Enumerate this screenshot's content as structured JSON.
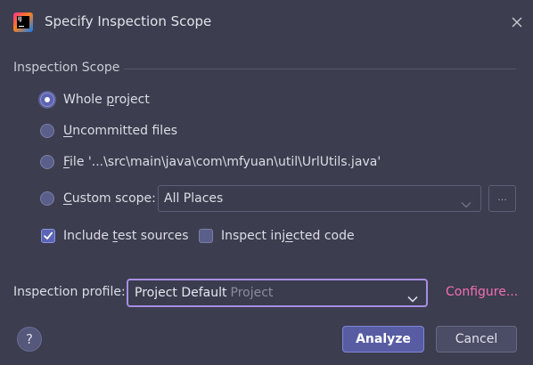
{
  "window": {
    "title": "Specify Inspection Scope",
    "logo_text": "IJ",
    "close_icon": "close-icon"
  },
  "scope": {
    "section_title": "Inspection Scope",
    "options": [
      {
        "pre": "Whole ",
        "key": "p",
        "post": "roject",
        "checked": true
      },
      {
        "pre": "",
        "key": "U",
        "post": "ncommitted files",
        "checked": false
      },
      {
        "pre": "",
        "key": "F",
        "post": "ile '...\\src\\main\\java\\com\\mfyuan\\util\\UrlUtils.java'",
        "checked": false
      },
      {
        "pre": "",
        "key": "C",
        "post": "ustom scope:",
        "checked": false
      }
    ],
    "custom_scope_value": "All Places",
    "ellipsis_label": "..."
  },
  "checkboxes": {
    "include_tests": {
      "pre": "Include ",
      "key": "t",
      "post": "est sources",
      "checked": true
    },
    "inject_code": {
      "pre": "Inspect inj",
      "key": "e",
      "post": "cted code",
      "checked": false
    }
  },
  "profile": {
    "label": "Inspection profile:",
    "value": "Project Default",
    "value_sub": "Project",
    "configure_label": "Configure..."
  },
  "buttons": {
    "help_label": "?",
    "analyze_label": "Analyze",
    "cancel_label": "Cancel"
  },
  "colors": {
    "background": "#3c3d4f",
    "accent": "#a78ee2",
    "link": "#f26fb2",
    "primary_button": "#585da3"
  }
}
